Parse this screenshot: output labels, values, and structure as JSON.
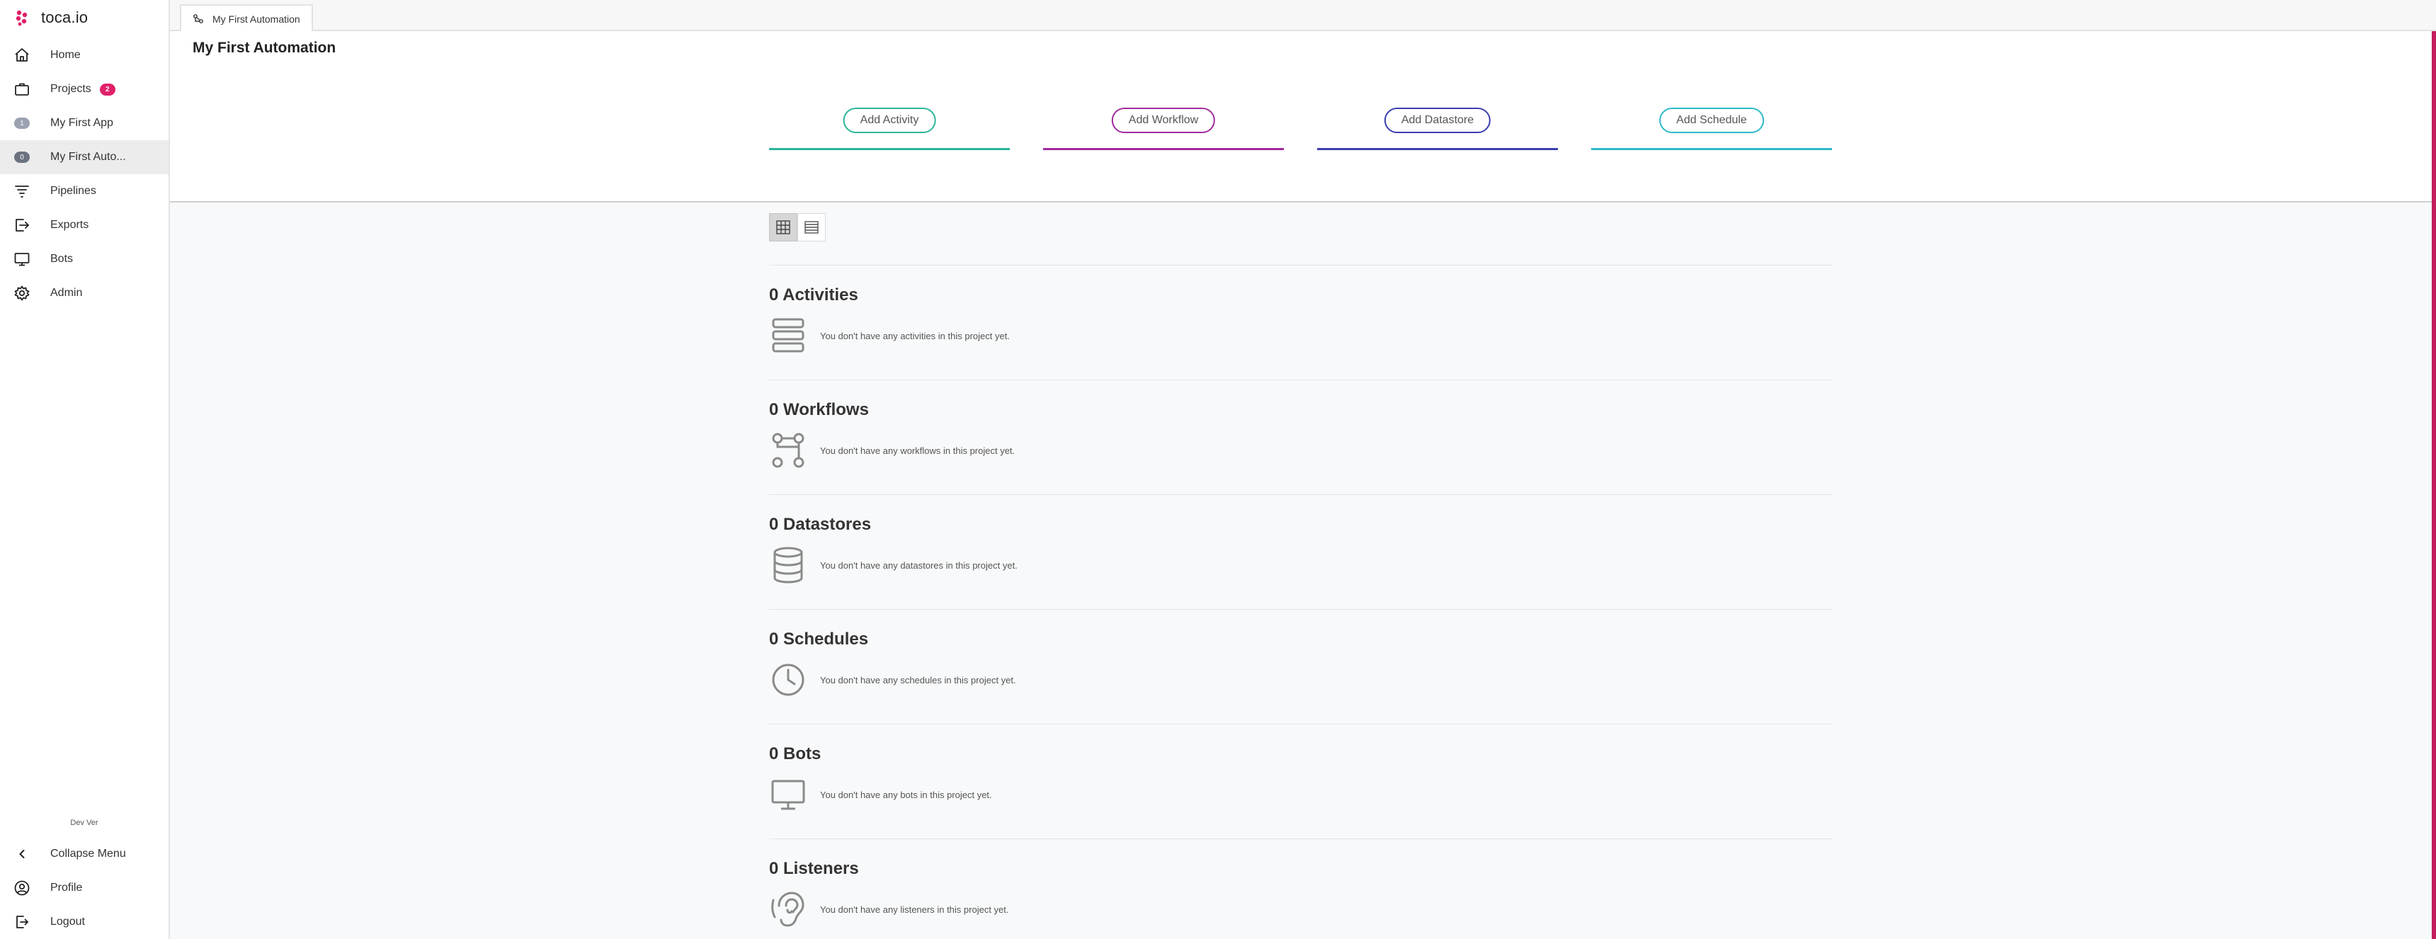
{
  "brand": {
    "name": "toca.io",
    "accent_color": "#e0216a"
  },
  "sidebar": {
    "items": [
      {
        "label": "Home",
        "icon": "home-icon"
      },
      {
        "label": "Projects",
        "icon": "briefcase-icon",
        "badge": "2"
      },
      {
        "label": "My First App",
        "icon": "app-number-icon",
        "number": "1"
      },
      {
        "label": "My First Auto...",
        "icon": "automation-number-icon",
        "number": "0"
      },
      {
        "label": "Pipelines",
        "icon": "filter-icon"
      },
      {
        "label": "Exports",
        "icon": "export-icon"
      },
      {
        "label": "Bots",
        "icon": "monitor-icon"
      },
      {
        "label": "Admin",
        "icon": "gear-icon"
      }
    ],
    "version": "Dev Ver",
    "bottom": [
      {
        "label": "Collapse Menu",
        "icon": "chevron-left-icon"
      },
      {
        "label": "Profile",
        "icon": "user-circle-icon"
      },
      {
        "label": "Logout",
        "icon": "logout-icon"
      }
    ]
  },
  "tabs": [
    {
      "label": "My First Automation",
      "icon": "automation-icon"
    }
  ],
  "header": {
    "title": "My First Automation",
    "buttons": [
      {
        "label": "Add Activity",
        "color": "#2bb59a"
      },
      {
        "label": "Add Workflow",
        "color": "#a12b9e"
      },
      {
        "label": "Add Datastore",
        "color": "#3b3fb0"
      },
      {
        "label": "Add Schedule",
        "color": "#2eb9c9"
      }
    ]
  },
  "view_toggle": {
    "selected": "grid",
    "options": [
      "grid",
      "list"
    ]
  },
  "sections": [
    {
      "title": "0 Activities",
      "empty": "You don't have any activities in this project yet.",
      "icon": "activities-stack-icon"
    },
    {
      "title": "0 Workflows",
      "empty": "You don't have any workflows in this project yet.",
      "icon": "workflow-nodes-icon"
    },
    {
      "title": "0 Datastores",
      "empty": "You don't have any datastores in this project yet.",
      "icon": "database-icon"
    },
    {
      "title": "0 Schedules",
      "empty": "You don't have any schedules in this project yet.",
      "icon": "clock-icon"
    },
    {
      "title": "0 Bots",
      "empty": "You don't have any bots in this project yet.",
      "icon": "monitor-icon"
    },
    {
      "title": "0 Listeners",
      "empty": "You don't have any listeners in this project yet.",
      "icon": "ear-icon"
    }
  ]
}
